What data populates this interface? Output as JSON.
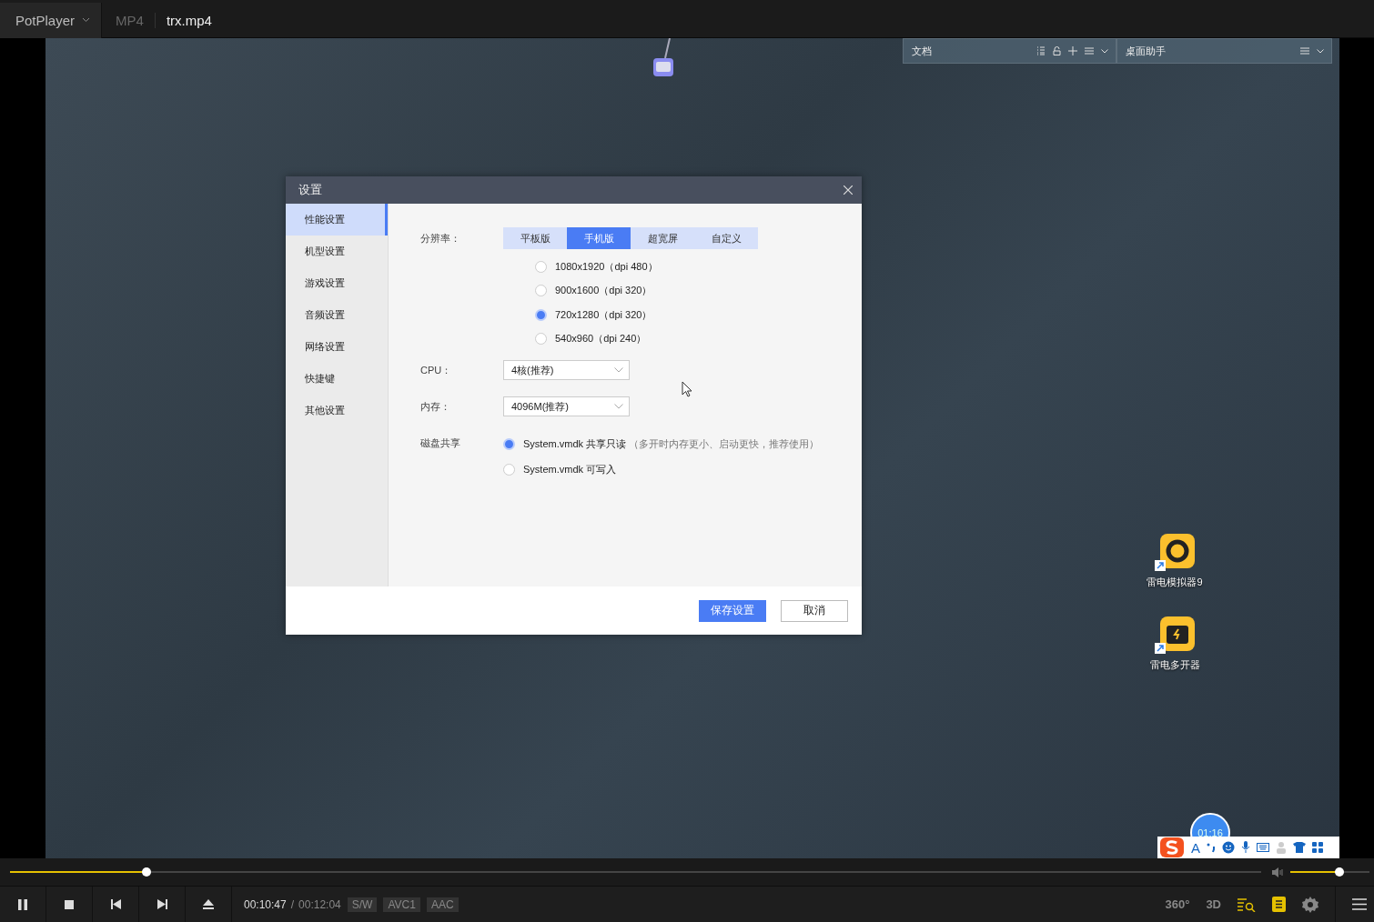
{
  "player": {
    "menu": "PotPlayer",
    "format": "MP4",
    "file": "trx.mp4"
  },
  "desktop": {
    "widgets": [
      {
        "title": "文档",
        "tools": [
          {
            "kind": "list"
          },
          {
            "kind": "lock"
          },
          {
            "kind": "add"
          },
          {
            "kind": "menu"
          },
          {
            "kind": "chevron"
          }
        ]
      },
      {
        "title": "桌面助手",
        "tools": [
          {
            "kind": "menu"
          },
          {
            "kind": "chevron"
          }
        ]
      }
    ],
    "icons": [
      {
        "label": "雷电模拟器9",
        "kind": "emulator"
      },
      {
        "label": "雷电多开器",
        "kind": "multi"
      }
    ],
    "timer": "01:16",
    "ime_letter": "A"
  },
  "dialog": {
    "title": "设置",
    "nav": [
      {
        "label": "性能设置",
        "selected": true
      },
      {
        "label": "机型设置",
        "selected": false
      },
      {
        "label": "游戏设置",
        "selected": false
      },
      {
        "label": "音频设置",
        "selected": false
      },
      {
        "label": "网络设置",
        "selected": false
      },
      {
        "label": "快捷键",
        "selected": false
      },
      {
        "label": "其他设置",
        "selected": false
      }
    ],
    "resolution_label": "分辨率：",
    "tabs": [
      {
        "label": "平板版",
        "selected": false
      },
      {
        "label": "手机版",
        "selected": true
      },
      {
        "label": "超宽屏",
        "selected": false
      },
      {
        "label": "自定义",
        "selected": false
      }
    ],
    "resolutions": [
      {
        "label": "1080x1920（dpi 480）",
        "selected": false
      },
      {
        "label": "900x1600（dpi 320）",
        "selected": false
      },
      {
        "label": "720x1280（dpi 320）",
        "selected": true
      },
      {
        "label": "540x960（dpi 240）",
        "selected": false
      }
    ],
    "cpu_label": "CPU：",
    "cpu_value": "4核(推荐)",
    "memory_label": "内存：",
    "memory_value": "4096M(推荐)",
    "disk_label": "磁盘共享",
    "disk_options": [
      {
        "label": "System.vmdk 共享只读",
        "note": "（多开时内存更小、启动更快，推荐使用）",
        "selected": true
      },
      {
        "label": "System.vmdk 可写入",
        "selected": false
      }
    ],
    "save": "保存设置",
    "cancel": "取消"
  },
  "seek": {
    "level": 0.109
  },
  "volume": {
    "level": 0.62
  },
  "controls": {
    "time": "00:10:47",
    "separator": "/",
    "duration": "00:12:04",
    "badges": [
      "S/W",
      "AVC1",
      "AAC"
    ],
    "view_360": "360°",
    "view_3d": "3D"
  }
}
